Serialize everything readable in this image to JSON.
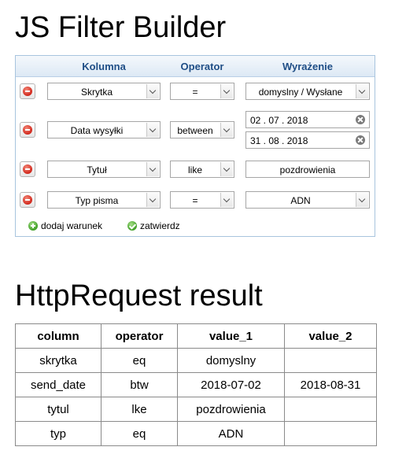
{
  "filter_builder": {
    "title": "JS Filter Builder",
    "columns": [
      "Kolumna",
      "Operator",
      "Wyrażenie"
    ],
    "rows": [
      {
        "column": "Skrytka",
        "operator": "=",
        "value": "domyslny / Wysłane"
      },
      {
        "column": "Data wysyłki",
        "operator": "between",
        "value_from": "02 . 07 . 2018",
        "value_to": "31 . 08 . 2018"
      },
      {
        "column": "Tytuł",
        "operator": "like",
        "value": "pozdrowienia"
      },
      {
        "column": "Typ pisma",
        "operator": "=",
        "value": "ADN"
      }
    ],
    "add_condition_label": "dodaj warunek",
    "confirm_label": "zatwierdz",
    "colors": {
      "header_text": "#1f4e86",
      "border": "#a8c4de",
      "delete": "#d0251a",
      "action": "#3e9e24"
    }
  },
  "result": {
    "title": "HttpRequest result",
    "headers": [
      "column",
      "operator",
      "value_1",
      "value_2"
    ],
    "rows": [
      [
        "skrytka",
        "eq",
        "domyslny",
        ""
      ],
      [
        "send_date",
        "btw",
        "2018-07-02",
        "2018-08-31"
      ],
      [
        "tytul",
        "lke",
        "pozdrowienia",
        ""
      ],
      [
        "typ",
        "eq",
        "ADN",
        ""
      ]
    ]
  }
}
